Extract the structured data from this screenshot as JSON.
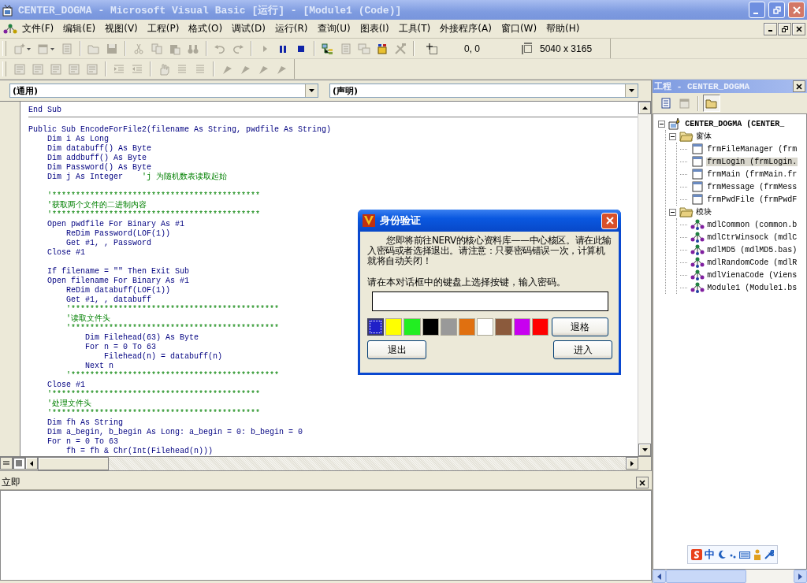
{
  "window": {
    "title": "CENTER_DOGMA - Microsoft Visual Basic [运行] - [Module1 (Code)]"
  },
  "menu": [
    {
      "label": "文件(F)"
    },
    {
      "label": "编辑(E)"
    },
    {
      "label": "视图(V)"
    },
    {
      "label": "工程(P)"
    },
    {
      "label": "格式(O)"
    },
    {
      "label": "调试(D)"
    },
    {
      "label": "运行(R)"
    },
    {
      "label": "查询(U)"
    },
    {
      "label": "图表(I)"
    },
    {
      "label": "工具(T)"
    },
    {
      "label": "外接程序(A)"
    },
    {
      "label": "窗口(W)"
    },
    {
      "label": "帮助(H)"
    }
  ],
  "toolbar_standard": {
    "buttons": [
      {
        "kind": "add_project",
        "disabled": true,
        "dropdown": true
      },
      {
        "kind": "add_form",
        "disabled": true,
        "dropdown": true
      },
      {
        "kind": "menu_editor",
        "disabled": true
      },
      {
        "kind": "separator"
      },
      {
        "kind": "open",
        "disabled": true
      },
      {
        "kind": "save",
        "disabled": true
      },
      {
        "kind": "separator"
      },
      {
        "kind": "cut",
        "disabled": true
      },
      {
        "kind": "copy",
        "disabled": true
      },
      {
        "kind": "paste",
        "disabled": true
      },
      {
        "kind": "find",
        "disabled": true
      },
      {
        "kind": "separator"
      },
      {
        "kind": "undo",
        "disabled": true
      },
      {
        "kind": "redo",
        "disabled": true
      },
      {
        "kind": "separator"
      },
      {
        "kind": "start",
        "disabled": true
      },
      {
        "kind": "break",
        "disabled": false
      },
      {
        "kind": "end",
        "disabled": false
      },
      {
        "kind": "separator"
      },
      {
        "kind": "project_explorer",
        "disabled": false
      },
      {
        "kind": "properties",
        "disabled": true
      },
      {
        "kind": "form_layout",
        "disabled": true
      },
      {
        "kind": "object_browser",
        "disabled": false
      },
      {
        "kind": "toolbox",
        "disabled": true
      }
    ],
    "position": "0, 0",
    "size": "5040 x 3165"
  },
  "toolbar_edit": {
    "buttons": [
      {
        "kind": "list_members",
        "disabled": true
      },
      {
        "kind": "list_constants",
        "disabled": true
      },
      {
        "kind": "quick_info",
        "disabled": true
      },
      {
        "kind": "parameter_info",
        "disabled": true
      },
      {
        "kind": "complete_word",
        "disabled": true
      },
      {
        "kind": "separator"
      },
      {
        "kind": "indent",
        "disabled": true
      },
      {
        "kind": "outdent",
        "disabled": true
      },
      {
        "kind": "separator"
      },
      {
        "kind": "breakpoint",
        "disabled": true
      },
      {
        "kind": "comment",
        "disabled": true
      },
      {
        "kind": "uncomment",
        "disabled": true
      },
      {
        "kind": "separator"
      },
      {
        "kind": "bookmark",
        "disabled": true
      },
      {
        "kind": "bookmark",
        "disabled": true
      },
      {
        "kind": "bookmark",
        "disabled": true
      },
      {
        "kind": "bookmark",
        "disabled": true
      }
    ]
  },
  "code_window": {
    "object": "(通用)",
    "procedure": "(声明)",
    "lines": [
      {
        "kind": "code",
        "text": "End Sub",
        "separator": true
      },
      {
        "kind": "blank"
      },
      {
        "kind": "code",
        "text": "Public Sub EncodeForFile2(filename As String, pwdfile As String)"
      },
      {
        "kind": "code",
        "text": "    Dim i As Long"
      },
      {
        "kind": "code",
        "text": "    Dim databuff() As Byte"
      },
      {
        "kind": "code",
        "text": "    Dim addbuff() As Byte"
      },
      {
        "kind": "code",
        "text": "    Dim Password() As Byte"
      },
      {
        "kind": "code",
        "text": "    Dim j As Integer",
        "comment": "'j 为随机数表读取起始"
      },
      {
        "kind": "blank"
      },
      {
        "kind": "comment",
        "text": "    '********************************************"
      },
      {
        "kind": "comment",
        "text": "    '获取两个文件的二进制内容"
      },
      {
        "kind": "comment",
        "text": "    '********************************************"
      },
      {
        "kind": "code",
        "text": "    Open pwdfile For Binary As #1"
      },
      {
        "kind": "code",
        "text": "        ReDim Password(LOF(1))"
      },
      {
        "kind": "code",
        "text": "        Get #1, , Password"
      },
      {
        "kind": "code",
        "text": "    Close #1"
      },
      {
        "kind": "blank"
      },
      {
        "kind": "code",
        "text": "    If filename = \"\" Then Exit Sub"
      },
      {
        "kind": "code",
        "text": "    Open filename For Binary As #1"
      },
      {
        "kind": "code",
        "text": "        ReDim databuff(LOF(1))"
      },
      {
        "kind": "code",
        "text": "        Get #1, , databuff"
      },
      {
        "kind": "comment",
        "text": "        '********************************************"
      },
      {
        "kind": "comment",
        "text": "        '读取文件头"
      },
      {
        "kind": "comment",
        "text": "        '********************************************"
      },
      {
        "kind": "code",
        "text": "            Dim Filehead(63) As Byte"
      },
      {
        "kind": "code",
        "text": "            For n = 0 To 63"
      },
      {
        "kind": "code",
        "text": "                Filehead(n) = databuff(n)"
      },
      {
        "kind": "code",
        "text": "            Next n"
      },
      {
        "kind": "comment",
        "text": "        '********************************************"
      },
      {
        "kind": "code",
        "text": "    Close #1"
      },
      {
        "kind": "comment",
        "text": "    '********************************************"
      },
      {
        "kind": "comment",
        "text": "    '处理文件头"
      },
      {
        "kind": "comment",
        "text": "    '********************************************"
      },
      {
        "kind": "code",
        "text": "    Dim fh As String"
      },
      {
        "kind": "code",
        "text": "    Dim a_begin, b_begin As Long: a_begin = 0: b_begin = 0"
      },
      {
        "kind": "code",
        "text": "    For n = 0 To 63"
      },
      {
        "kind": "code",
        "text": "        fh = fh & Chr(Int(Filehead(n)))"
      }
    ]
  },
  "immediate": {
    "title": "立即"
  },
  "project": {
    "title": "工程 - CENTER_DOGMA",
    "buttons": [
      {
        "kind": "view_code",
        "disabled": false,
        "pressed": false
      },
      {
        "kind": "view_object",
        "disabled": true,
        "pressed": false
      },
      {
        "kind": "toggle_folders",
        "disabled": false,
        "pressed": true
      }
    ],
    "tree": {
      "kind": "project",
      "label": "CENTER_DOGMA (CENTER_",
      "expanded": true,
      "children": [
        {
          "kind": "folder",
          "label": "窗体",
          "expanded": true,
          "children": [
            {
              "kind": "form",
              "label": "frmFileManager (frm",
              "selected": false
            },
            {
              "kind": "form",
              "label": "frmLogin (frmLogin.",
              "selected": true
            },
            {
              "kind": "form",
              "label": "frmMain (frmMain.fr",
              "selected": false
            },
            {
              "kind": "form",
              "label": "frmMessage (frmMess",
              "selected": false
            },
            {
              "kind": "form",
              "label": "frmPwdFile (frmPwdF",
              "selected": false
            }
          ]
        },
        {
          "kind": "folder",
          "label": "模块",
          "expanded": true,
          "children": [
            {
              "kind": "module",
              "label": "mdlCommon (common.b",
              "selected": false
            },
            {
              "kind": "module",
              "label": "mdlCtrWinsock (mdlC",
              "selected": false
            },
            {
              "kind": "module",
              "label": "mdlMD5 (mdlMD5.bas)",
              "selected": false
            },
            {
              "kind": "module",
              "label": "mdlRandomCode (mdlR",
              "selected": false
            },
            {
              "kind": "module",
              "label": "mdlVienaCode (Viens",
              "selected": false
            },
            {
              "kind": "module",
              "label": "Module1 (Module1.bs",
              "selected": false
            }
          ]
        }
      ]
    }
  },
  "ime_bar": {
    "mode": "中"
  },
  "dialog": {
    "title": "身份验证",
    "message": "您即将前往NERV的核心资料库——中心核区。请在此输入密码或者选择退出。请注意：只要密码错误一次，计算机就将自动关闭！",
    "prompt": "请在本对话框中的键盘上选择按键，输入密码。",
    "keys": [
      {
        "color": "#2020c8",
        "selected": true
      },
      {
        "color": "#ffff00",
        "selected": false
      },
      {
        "color": "#22ee22",
        "selected": false
      },
      {
        "color": "#000000",
        "selected": false
      },
      {
        "color": "#999999",
        "selected": false
      },
      {
        "color": "#e07010",
        "selected": false
      },
      {
        "color": "#ffffff",
        "selected": false
      },
      {
        "color": "#8b5a3c",
        "selected": false
      },
      {
        "color": "#c800f0",
        "selected": false
      },
      {
        "color": "#ff0000",
        "selected": false
      }
    ],
    "backspace_button": "退格",
    "exit_button": "退出",
    "enter_button": "进入"
  }
}
